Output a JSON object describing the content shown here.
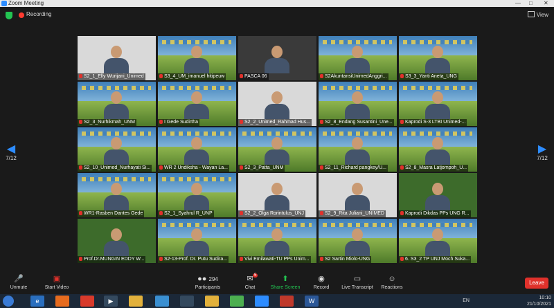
{
  "window": {
    "title": "Zoom Meeting"
  },
  "status": {
    "recording_label": "Recording"
  },
  "view_button": {
    "label": "View"
  },
  "pager": {
    "left": "7/12",
    "right": "7/12"
  },
  "participants_grid": [
    {
      "name": "S2_1_Elly Wurijani_Unimed",
      "style": "plain"
    },
    {
      "name": "S3_4_UM_imanuel hitipeuw",
      "style": "banner"
    },
    {
      "name": "PASCA 06",
      "style": "dark"
    },
    {
      "name": "S2AkuntansiUnimedAnggri...",
      "style": "banner"
    },
    {
      "name": "S3_3_Yanti Aneta_UNG",
      "style": "banner"
    },
    {
      "name": "S2_3_Nurhikmah_UNM",
      "style": "banner"
    },
    {
      "name": "I Gede Sudirtha",
      "style": "banner"
    },
    {
      "name": "S2_2_Unimed_Rahmad Hus...",
      "style": "plain"
    },
    {
      "name": "S2_8_Endang Susantini_Une...",
      "style": "banner"
    },
    {
      "name": "Kaprodi S-3 LTBI Unimed-...",
      "style": "banner"
    },
    {
      "name": "S2_10_Unimed_Nurhayati Si...",
      "style": "banner"
    },
    {
      "name": "WR 2 Undiksha - Wayan La...",
      "style": "banner"
    },
    {
      "name": "S2_3_Patta_UNM",
      "style": "banner"
    },
    {
      "name": "S2_11_Richard pangkey/U...",
      "style": "banner"
    },
    {
      "name": "S2_8_Masra Latjompoh_U...",
      "style": "banner"
    },
    {
      "name": "WR1-Rasben Dantes Gede",
      "style": "banner"
    },
    {
      "name": "S2_1_Syahrul R_UNP",
      "style": "banner"
    },
    {
      "name": "S2_2_Olga Rorintulus_UNJ",
      "style": "plain"
    },
    {
      "name": "S2_9_Rita Juliani_UNIMED",
      "style": "plain"
    },
    {
      "name": "Kaprodi Dikdas PPs UNG R...",
      "style": "green"
    },
    {
      "name": "Prof.Dr.MUNGIN EDDY W...",
      "style": "green"
    },
    {
      "name": "S2-13-Prof. Dr. Putu Sudira...",
      "style": "banner"
    },
    {
      "name": "Vivi Emilawati-TU PPs Unim...",
      "style": "banner"
    },
    {
      "name": "S2 Sartin Miolo-UNG",
      "style": "banner"
    },
    {
      "name": "6. S3_2 TP UNJ Moch Suka...",
      "style": "banner"
    }
  ],
  "toolbar": {
    "unmute": "Unmute",
    "start_video": "Start Video",
    "participants": "Participants",
    "participants_count": "294",
    "chat": "Chat",
    "chat_badge": "5",
    "share_screen": "Share Screen",
    "record": "Record",
    "live_transcript": "Live Transcript",
    "reactions": "Reactions",
    "leave": "Leave"
  },
  "taskbar": {
    "language": "EN",
    "time": "10:10",
    "date": "21/10/2021"
  }
}
